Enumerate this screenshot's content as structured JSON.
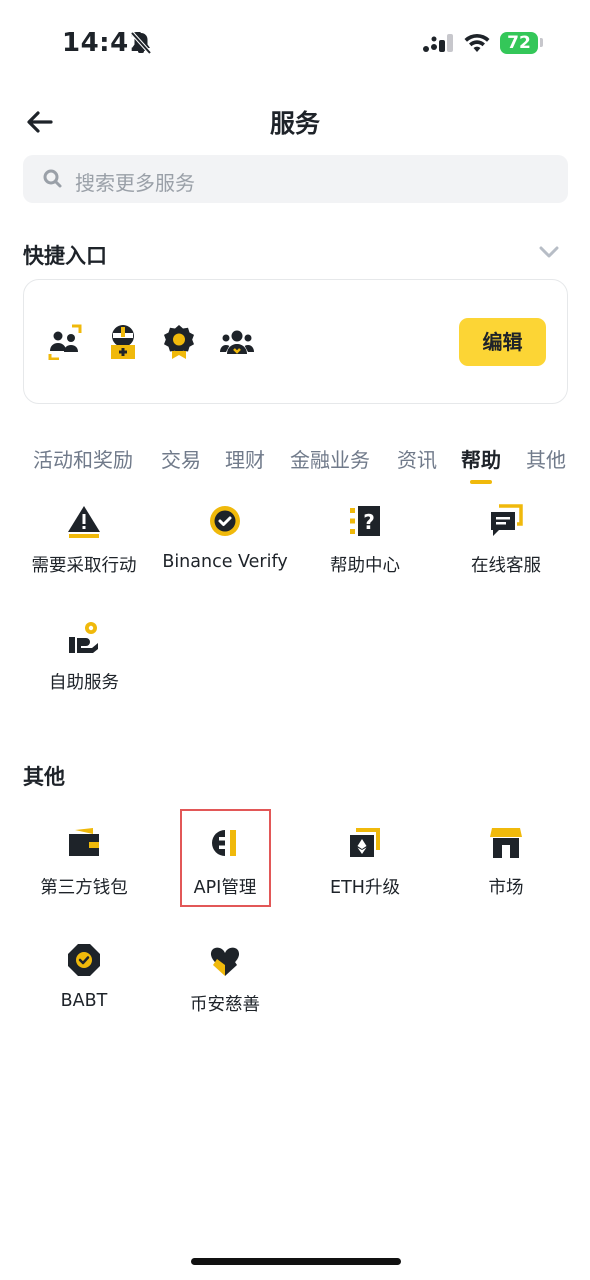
{
  "status_bar": {
    "time": "14:41",
    "battery": "72"
  },
  "header": {
    "title": "服务"
  },
  "search": {
    "placeholder": "搜索更多服务"
  },
  "quick_entry": {
    "title": "快捷入口",
    "edit_label": "编辑",
    "icons": [
      "users-swap-icon",
      "robot-icon",
      "award-badge-icon",
      "group-icon"
    ]
  },
  "tabs": [
    {
      "label": "活动和奖励"
    },
    {
      "label": "交易"
    },
    {
      "label": "理财"
    },
    {
      "label": "金融业务"
    },
    {
      "label": "资讯"
    },
    {
      "label": "帮助",
      "active": true
    },
    {
      "label": "其他"
    }
  ],
  "help_items": [
    {
      "label": "需要采取行动",
      "icon": "warning-icon"
    },
    {
      "label": "Binance Verify",
      "icon": "verify-check-icon"
    },
    {
      "label": "帮助中心",
      "icon": "help-center-icon"
    },
    {
      "label": "在线客服",
      "icon": "chat-support-icon"
    },
    {
      "label": "自助服务",
      "icon": "self-service-icon"
    }
  ],
  "other_section": {
    "title": "其他",
    "items": [
      {
        "label": "第三方钱包",
        "icon": "wallet-icon"
      },
      {
        "label": "API管理",
        "icon": "api-icon"
      },
      {
        "label": "ETH升级",
        "icon": "eth-upgrade-icon"
      },
      {
        "label": "市场",
        "icon": "market-icon"
      },
      {
        "label": "BABT",
        "icon": "babt-icon"
      },
      {
        "label": "币安慈善",
        "icon": "charity-heart-icon"
      }
    ]
  },
  "colors": {
    "accent": "#fcd535",
    "brand_yellow": "#f0b90b",
    "icon_dark": "#1e2329",
    "highlight": "#e25757"
  }
}
